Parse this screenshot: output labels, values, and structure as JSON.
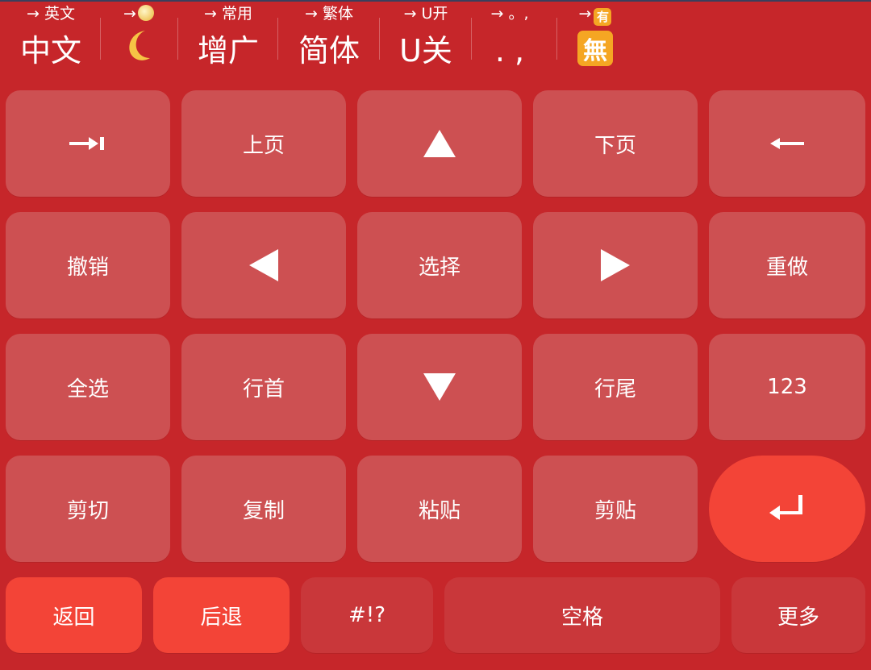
{
  "toggles": [
    {
      "hint": "→ 英文",
      "current": "中文"
    },
    {
      "hint": "→",
      "hint_icon": "full-moon-icon",
      "current_icon": "crescent-moon-icon"
    },
    {
      "hint": "→ 常用",
      "current": "增广"
    },
    {
      "hint": "→ 繁体",
      "current": "简体"
    },
    {
      "hint": "→ U开",
      "current": "U关"
    },
    {
      "hint": "→ 。,",
      "current": ". ,"
    },
    {
      "hint": "→",
      "hint_icon": "有",
      "current_icon": "無"
    }
  ],
  "keys": {
    "tab": {
      "icon": "tab-arrow-icon"
    },
    "page_up": "上页",
    "up": {
      "icon": "up-triangle-icon"
    },
    "page_down": "下页",
    "backspace": {
      "icon": "left-arrow-icon"
    },
    "undo": "撤销",
    "left": {
      "icon": "left-triangle-icon"
    },
    "select": "选择",
    "right": {
      "icon": "right-triangle-icon"
    },
    "redo": "重做",
    "select_all": "全选",
    "home": "行首",
    "down": {
      "icon": "down-triangle-icon"
    },
    "end": "行尾",
    "numbers": "123",
    "cut": "剪切",
    "copy": "复制",
    "paste": "粘贴",
    "clipboard": "剪贴",
    "enter": {
      "icon": "enter-return-icon"
    }
  },
  "bottom_row": {
    "back": "返回",
    "delete_back": "后退",
    "symbols": "#!?",
    "space": "空格",
    "more": "更多"
  },
  "colors": {
    "background": "#c6262a",
    "key": "#cd5052",
    "accent_key": "#f34437",
    "dark_key": "#c9373a",
    "text": "#ffffff"
  }
}
